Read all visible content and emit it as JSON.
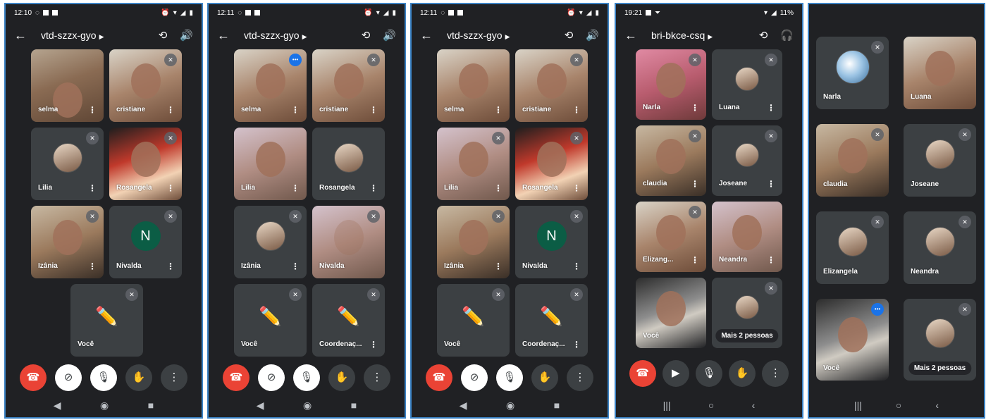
{
  "screens": [
    {
      "time": "12:10",
      "code": "vtd-szzx-gyo",
      "tiles": [
        "selma",
        "cristiane",
        "Lilia",
        "Rosangela",
        "Izânia",
        "Nivalda",
        "Você"
      ],
      "avatar_letter": "N"
    },
    {
      "time": "12:11",
      "code": "vtd-szzx-gyo",
      "tiles": [
        "selma",
        "cristiane",
        "Lilia",
        "Rosangela",
        "Izânia",
        "Nivalda",
        "Você",
        "Coordenaç..."
      ]
    },
    {
      "time": "12:11",
      "code": "vtd-szzx-gyo",
      "tiles": [
        "selma",
        "cristiane",
        "Lilia",
        "Rosangela",
        "Izânia",
        "Nivalda",
        "Você",
        "Coordenaç..."
      ],
      "avatar_letter": "N"
    },
    {
      "time": "19:21",
      "battery": "11%",
      "code": "bri-bkce-csq",
      "tiles": [
        "Narla",
        "Luana",
        "claudia",
        "Joseane",
        "Elizang...",
        "Neandra",
        "Você",
        "Mais 2 pessoas"
      ]
    },
    {
      "tiles": [
        "Narla",
        "Luana",
        "claudia",
        "Joseane",
        "Elizangela",
        "Neandra",
        "Você",
        "Mais 2 pessoas"
      ]
    }
  ]
}
